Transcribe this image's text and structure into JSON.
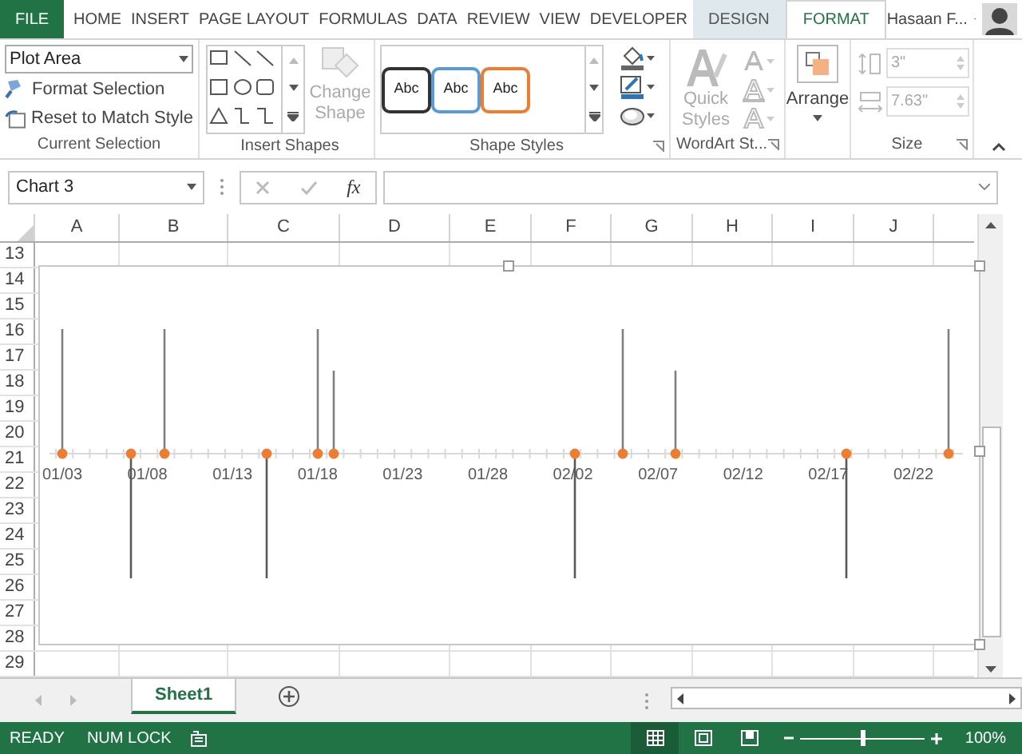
{
  "ribbon_tabs": [
    {
      "label": "FILE",
      "kind": "file",
      "selected": false
    },
    {
      "label": "HOME",
      "kind": "normal",
      "selected": false
    },
    {
      "label": "INSERT",
      "kind": "normal",
      "selected": false
    },
    {
      "label": "PAGE LAYOUT",
      "kind": "normal",
      "selected": false
    },
    {
      "label": "FORMULAS",
      "kind": "normal",
      "selected": false
    },
    {
      "label": "DATA",
      "kind": "normal",
      "selected": false
    },
    {
      "label": "REVIEW",
      "kind": "normal",
      "selected": false
    },
    {
      "label": "VIEW",
      "kind": "normal",
      "selected": false
    },
    {
      "label": "DEVELOPER",
      "kind": "normal",
      "selected": false
    },
    {
      "label": "DESIGN",
      "kind": "contextual",
      "selected": false
    },
    {
      "label": "FORMAT",
      "kind": "contextual",
      "selected": true
    }
  ],
  "account": {
    "name": "Hasaan F..."
  },
  "ribbon": {
    "current_selection": {
      "dropdown": "Plot Area",
      "buttons": [
        "Format Selection",
        "Reset to Match Style"
      ],
      "label": "Current Selection"
    },
    "insert_shapes": {
      "change_shape": {
        "label": "Change Shape",
        "disabled": true
      },
      "label": "Insert Shapes"
    },
    "shape_styles": {
      "presets": [
        "Abc",
        "Abc",
        "Abc"
      ],
      "label": "Shape Styles"
    },
    "wordart": {
      "quick_styles": {
        "label": "Quick Styles",
        "disabled": true
      },
      "label": "WordArt St..."
    },
    "arrange": {
      "label": "Arrange"
    },
    "size": {
      "fields": [
        {
          "value": "3\"",
          "disabled": true
        },
        {
          "value": "7.63\"",
          "disabled": true
        }
      ],
      "label": "Size"
    }
  },
  "name_box": "Chart 3",
  "fx": "fx",
  "columns": [
    "A",
    "B",
    "C",
    "D",
    "E",
    "F",
    "G",
    "H",
    "I",
    "J"
  ],
  "rows": [
    "13",
    "14",
    "15",
    "16",
    "17",
    "18",
    "19",
    "20",
    "21",
    "22",
    "23",
    "24",
    "25",
    "26",
    "27",
    "28",
    "29"
  ],
  "chart": {
    "axis_labels": [
      "01/03",
      "01/08",
      "01/13",
      "01/18",
      "01/23",
      "01/28",
      "02/02",
      "02/07",
      "02/12",
      "02/17",
      "02/22"
    ]
  },
  "sheet_tabs": [
    {
      "label": "Sheet1",
      "selected": true
    }
  ],
  "status_bar": {
    "mode": "READY",
    "num_lock": "NUM LOCK",
    "zoom": {
      "level": 0.5,
      "reading": "100%"
    }
  }
}
